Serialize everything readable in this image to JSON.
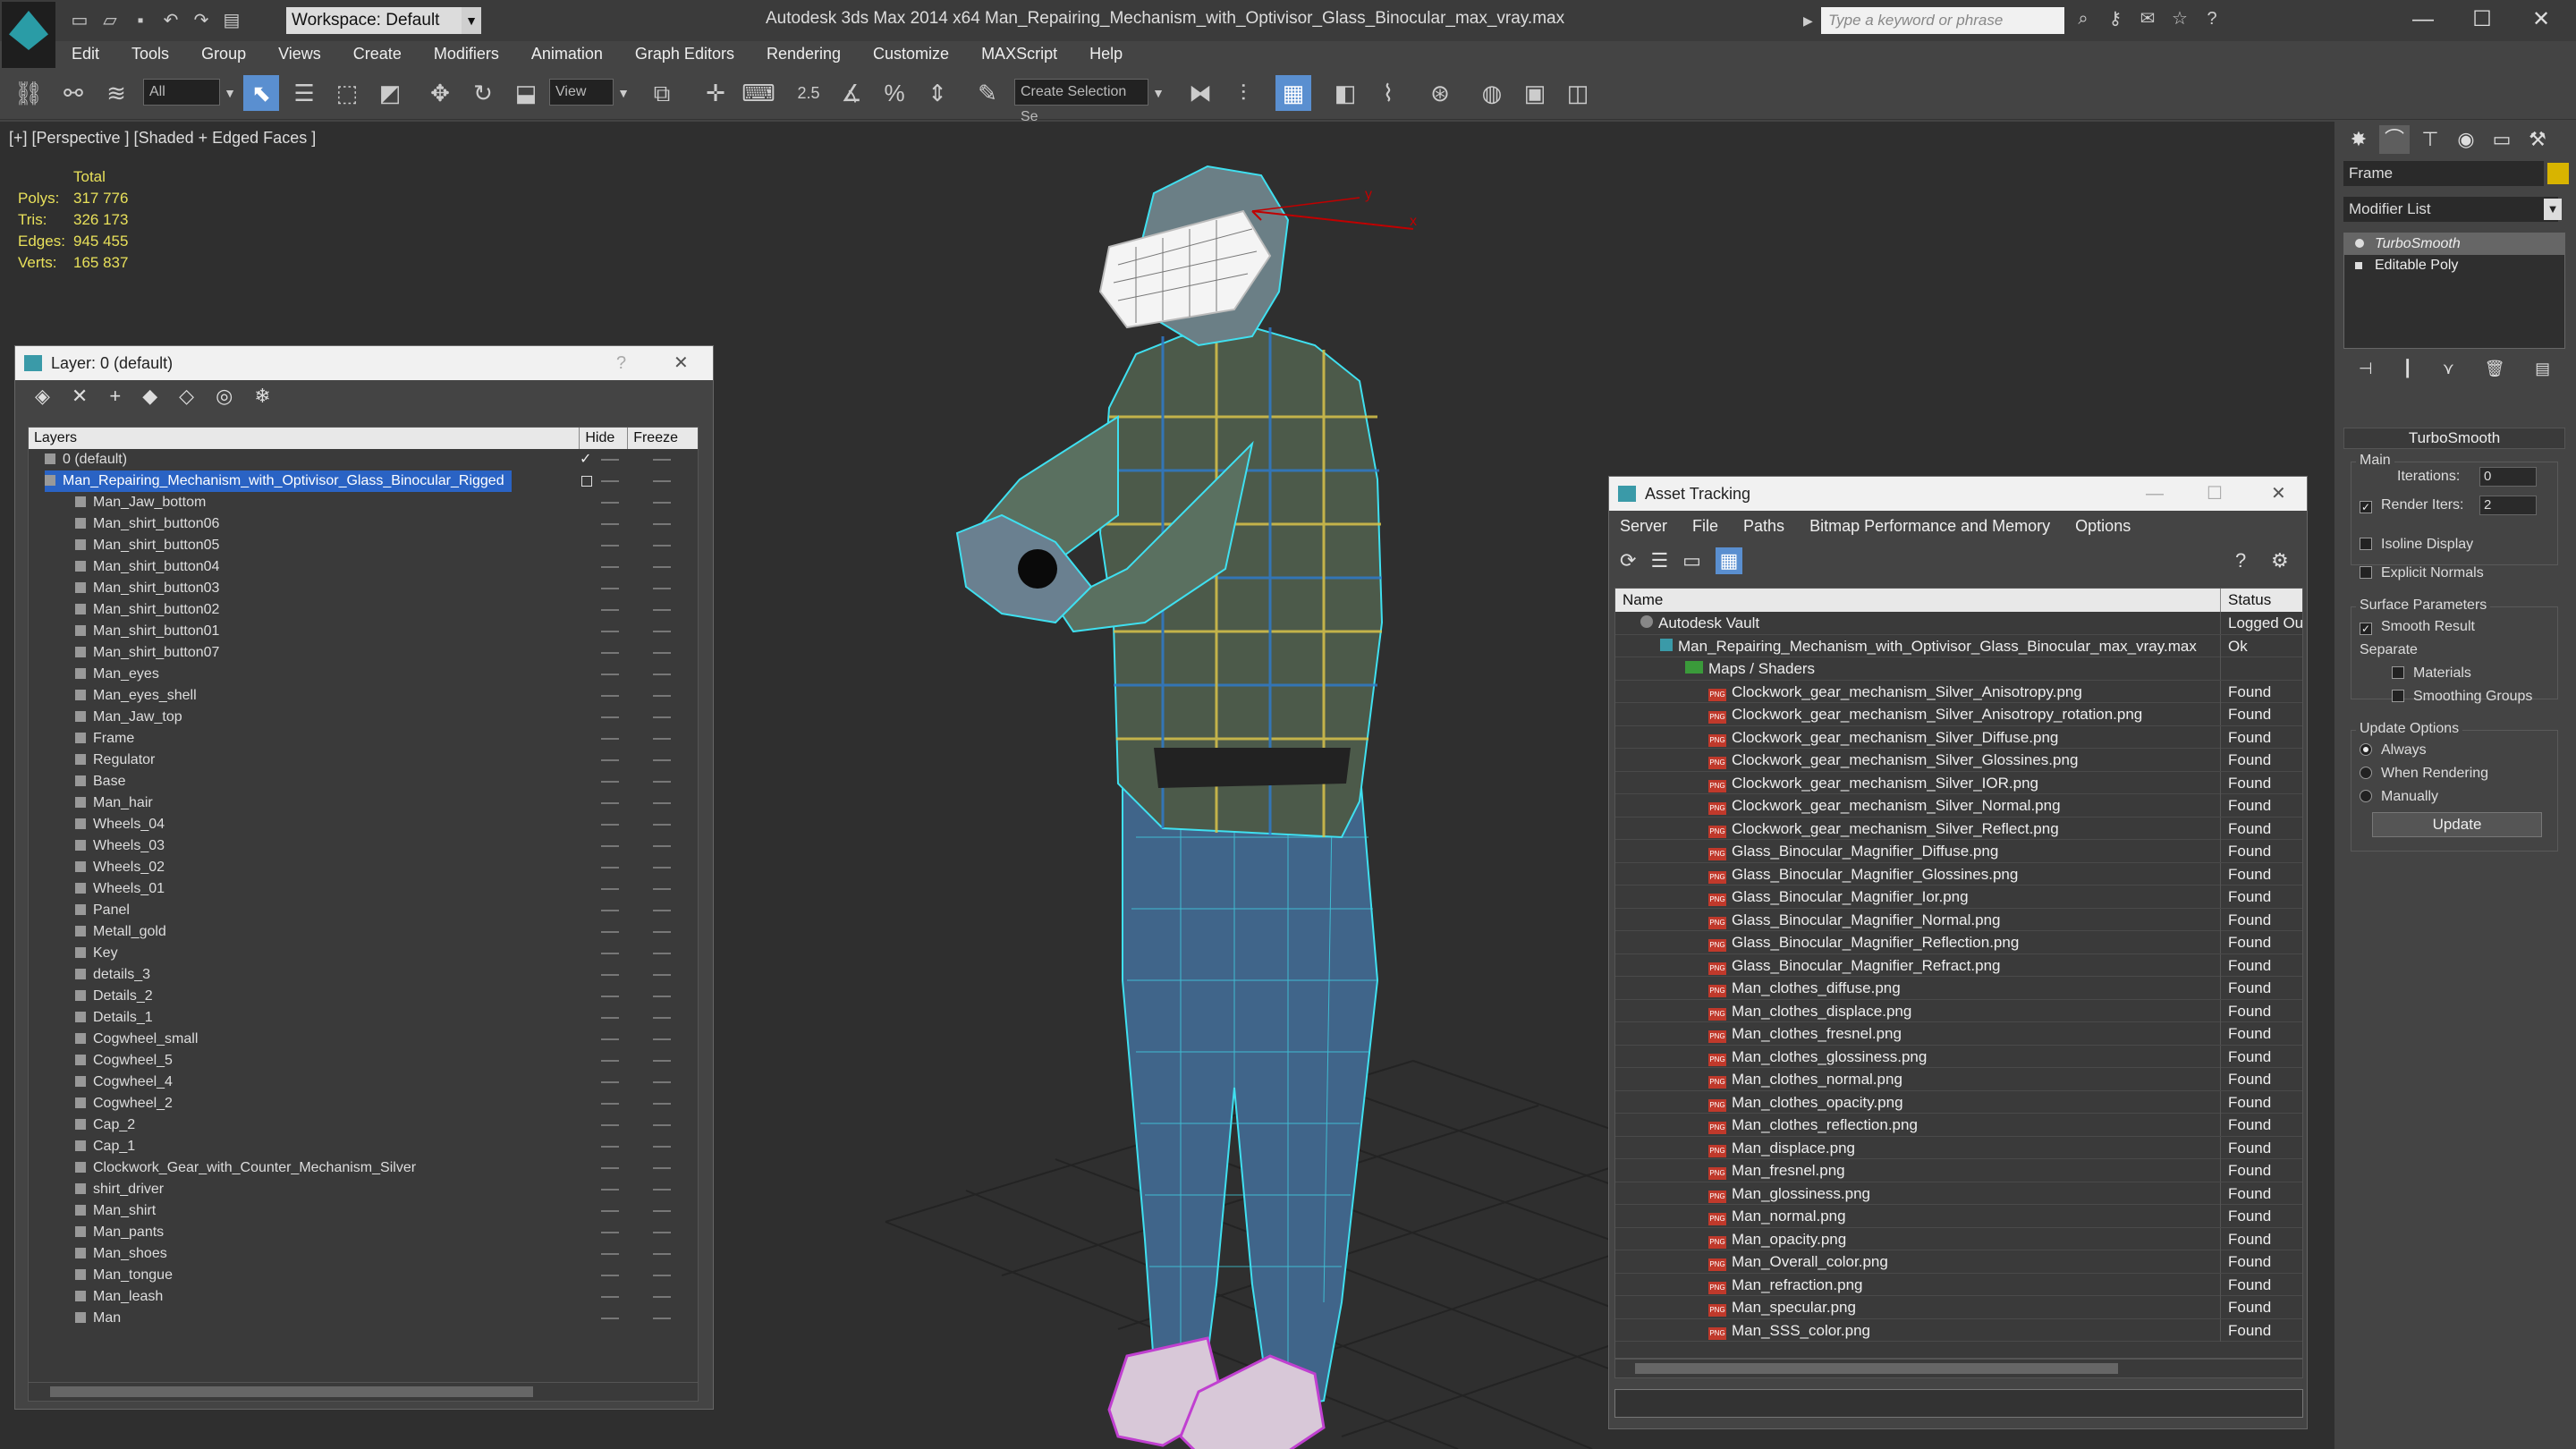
{
  "app": {
    "title": "Autodesk 3ds Max  2014 x64      Man_Repairing_Mechanism_with_Optivisor_Glass_Binocular_max_vray.max",
    "workspace": "Workspace: Default",
    "search_placeholder": "Type a keyword or phrase"
  },
  "menus": [
    "Edit",
    "Tools",
    "Group",
    "Views",
    "Create",
    "Modifiers",
    "Animation",
    "Graph Editors",
    "Rendering",
    "Customize",
    "MAXScript",
    "Help"
  ],
  "toolbar": {
    "selection_filter": "All",
    "ref_coord": "View",
    "named_selection": "Create Selection Se",
    "snap_value": "2.5"
  },
  "viewport": {
    "label": "[+] [Perspective ] [Shaded + Edged Faces ]",
    "stats": {
      "header": "Total",
      "rows": [
        {
          "k": "Polys:",
          "v": "317 776"
        },
        {
          "k": "Tris:",
          "v": "326 173"
        },
        {
          "k": "Edges:",
          "v": "945 455"
        },
        {
          "k": "Verts:",
          "v": "165 837"
        }
      ]
    },
    "gizmo": {
      "x": "x",
      "y": "y"
    }
  },
  "layer_window": {
    "title": "Layer: 0 (default)",
    "help": "?",
    "close": "✕",
    "columns": {
      "layers": "Layers",
      "hide": "Hide",
      "freeze": "Freeze"
    },
    "rows": [
      {
        "name": "0 (default)",
        "level": 1,
        "active": true
      },
      {
        "name": "Man_Repairing_Mechanism_with_Optivisor_Glass_Binocular_Rigged",
        "level": 1,
        "selected": true
      },
      {
        "name": "Man_Jaw_bottom",
        "level": 2
      },
      {
        "name": "Man_shirt_button06",
        "level": 2
      },
      {
        "name": "Man_shirt_button05",
        "level": 2
      },
      {
        "name": "Man_shirt_button04",
        "level": 2
      },
      {
        "name": "Man_shirt_button03",
        "level": 2
      },
      {
        "name": "Man_shirt_button02",
        "level": 2
      },
      {
        "name": "Man_shirt_button01",
        "level": 2
      },
      {
        "name": "Man_shirt_button07",
        "level": 2
      },
      {
        "name": "Man_eyes",
        "level": 2
      },
      {
        "name": "Man_eyes_shell",
        "level": 2
      },
      {
        "name": "Man_Jaw_top",
        "level": 2
      },
      {
        "name": "Frame",
        "level": 2
      },
      {
        "name": "Regulator",
        "level": 2
      },
      {
        "name": "Base",
        "level": 2
      },
      {
        "name": "Man_hair",
        "level": 2
      },
      {
        "name": "Wheels_04",
        "level": 2
      },
      {
        "name": "Wheels_03",
        "level": 2
      },
      {
        "name": "Wheels_02",
        "level": 2
      },
      {
        "name": "Wheels_01",
        "level": 2
      },
      {
        "name": "Panel",
        "level": 2
      },
      {
        "name": "Metall_gold",
        "level": 2
      },
      {
        "name": "Key",
        "level": 2
      },
      {
        "name": "details_3",
        "level": 2
      },
      {
        "name": "Details_2",
        "level": 2
      },
      {
        "name": "Details_1",
        "level": 2
      },
      {
        "name": "Cogwheel_small",
        "level": 2
      },
      {
        "name": "Cogwheel_5",
        "level": 2
      },
      {
        "name": "Cogwheel_4",
        "level": 2
      },
      {
        "name": "Cogwheel_2",
        "level": 2
      },
      {
        "name": "Cap_2",
        "level": 2
      },
      {
        "name": "Cap_1",
        "level": 2
      },
      {
        "name": "Clockwork_Gear_with_Counter_Mechanism_Silver",
        "level": 2
      },
      {
        "name": "shirt_driver",
        "level": 2
      },
      {
        "name": "Man_shirt",
        "level": 2
      },
      {
        "name": "Man_pants",
        "level": 2
      },
      {
        "name": "Man_shoes",
        "level": 2
      },
      {
        "name": "Man_tongue",
        "level": 2
      },
      {
        "name": "Man_leash",
        "level": 2
      },
      {
        "name": "Man",
        "level": 2
      }
    ]
  },
  "asset_window": {
    "title": "Asset Tracking",
    "menus": [
      "Server",
      "File",
      "Paths",
      "Bitmap Performance and Memory",
      "Options"
    ],
    "columns": {
      "name": "Name",
      "status": "Status"
    },
    "rows": [
      {
        "name": "Autodesk Vault",
        "status": "Logged Ou",
        "level": 1,
        "kind": "vault"
      },
      {
        "name": "Man_Repairing_Mechanism_with_Optivisor_Glass_Binocular_max_vray.max",
        "status": "Ok",
        "level": 2,
        "kind": "max"
      },
      {
        "name": "Maps / Shaders",
        "status": "",
        "level": 3,
        "kind": "folder"
      },
      {
        "name": "Clockwork_gear_mechanism_Silver_Anisotropy.png",
        "status": "Found",
        "level": 4,
        "kind": "png"
      },
      {
        "name": "Clockwork_gear_mechanism_Silver_Anisotropy_rotation.png",
        "status": "Found",
        "level": 4,
        "kind": "png"
      },
      {
        "name": "Clockwork_gear_mechanism_Silver_Diffuse.png",
        "status": "Found",
        "level": 4,
        "kind": "png"
      },
      {
        "name": "Clockwork_gear_mechanism_Silver_Glossines.png",
        "status": "Found",
        "level": 4,
        "kind": "png"
      },
      {
        "name": "Clockwork_gear_mechanism_Silver_IOR.png",
        "status": "Found",
        "level": 4,
        "kind": "png"
      },
      {
        "name": "Clockwork_gear_mechanism_Silver_Normal.png",
        "status": "Found",
        "level": 4,
        "kind": "png"
      },
      {
        "name": "Clockwork_gear_mechanism_Silver_Reflect.png",
        "status": "Found",
        "level": 4,
        "kind": "png"
      },
      {
        "name": "Glass_Binocular_Magnifier_Diffuse.png",
        "status": "Found",
        "level": 4,
        "kind": "png"
      },
      {
        "name": "Glass_Binocular_Magnifier_Glossines.png",
        "status": "Found",
        "level": 4,
        "kind": "png"
      },
      {
        "name": "Glass_Binocular_Magnifier_Ior.png",
        "status": "Found",
        "level": 4,
        "kind": "png"
      },
      {
        "name": "Glass_Binocular_Magnifier_Normal.png",
        "status": "Found",
        "level": 4,
        "kind": "png"
      },
      {
        "name": "Glass_Binocular_Magnifier_Reflection.png",
        "status": "Found",
        "level": 4,
        "kind": "png"
      },
      {
        "name": "Glass_Binocular_Magnifier_Refract.png",
        "status": "Found",
        "level": 4,
        "kind": "png"
      },
      {
        "name": "Man_clothes_diffuse.png",
        "status": "Found",
        "level": 4,
        "kind": "png"
      },
      {
        "name": "Man_clothes_displace.png",
        "status": "Found",
        "level": 4,
        "kind": "png"
      },
      {
        "name": "Man_clothes_fresnel.png",
        "status": "Found",
        "level": 4,
        "kind": "png"
      },
      {
        "name": "Man_clothes_glossiness.png",
        "status": "Found",
        "level": 4,
        "kind": "png"
      },
      {
        "name": "Man_clothes_normal.png",
        "status": "Found",
        "level": 4,
        "kind": "png"
      },
      {
        "name": "Man_clothes_opacity.png",
        "status": "Found",
        "level": 4,
        "kind": "png"
      },
      {
        "name": "Man_clothes_reflection.png",
        "status": "Found",
        "level": 4,
        "kind": "png"
      },
      {
        "name": "Man_displace.png",
        "status": "Found",
        "level": 4,
        "kind": "png"
      },
      {
        "name": "Man_fresnel.png",
        "status": "Found",
        "level": 4,
        "kind": "png"
      },
      {
        "name": "Man_glossiness.png",
        "status": "Found",
        "level": 4,
        "kind": "png"
      },
      {
        "name": "Man_normal.png",
        "status": "Found",
        "level": 4,
        "kind": "png"
      },
      {
        "name": "Man_opacity.png",
        "status": "Found",
        "level": 4,
        "kind": "png"
      },
      {
        "name": "Man_Overall_color.png",
        "status": "Found",
        "level": 4,
        "kind": "png"
      },
      {
        "name": "Man_refraction.png",
        "status": "Found",
        "level": 4,
        "kind": "png"
      },
      {
        "name": "Man_specular.png",
        "status": "Found",
        "level": 4,
        "kind": "png"
      },
      {
        "name": "Man_SSS_color.png",
        "status": "Found",
        "level": 4,
        "kind": "png"
      }
    ]
  },
  "command_panel": {
    "object_name": "Frame",
    "modifier_list": "Modifier List",
    "stack": [
      "TurboSmooth",
      "Editable Poly"
    ],
    "rollout": "TurboSmooth",
    "main": {
      "label": "Main",
      "iterations_label": "Iterations:",
      "iterations": "0",
      "render_iters_label": "Render Iters:",
      "render_iters": "2",
      "isoline": "Isoline Display",
      "explicit": "Explicit Normals"
    },
    "surface": {
      "label": "Surface Parameters",
      "smooth": "Smooth Result",
      "separate": "Separate",
      "materials": "Materials",
      "smoothing": "Smoothing Groups"
    },
    "update": {
      "label": "Update Options",
      "always": "Always",
      "when_rendering": "When Rendering",
      "manually": "Manually",
      "button": "Update"
    }
  },
  "colors": {
    "accent": "#2a63c4",
    "wire": "#3fe0f0",
    "shoes": "#c040d0",
    "stats": "#e8e05a"
  }
}
